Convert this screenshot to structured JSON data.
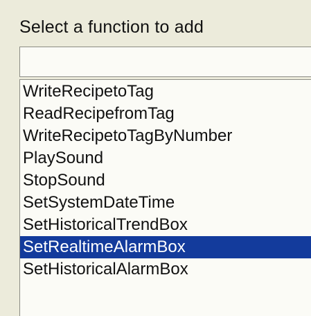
{
  "dialog": {
    "prompt": "Select a function to add",
    "search": {
      "value": "",
      "placeholder": ""
    },
    "functions": [
      "WriteRecipetoTag",
      "ReadRecipefromTag",
      "WriteRecipetoTagByNumber",
      "PlaySound",
      "StopSound",
      "SetSystemDateTime",
      "SetHistoricalTrendBox",
      "SetRealtimeAlarmBox",
      "SetHistoricalAlarmBox"
    ],
    "selected_function": "SetRealtimeAlarmBox"
  },
  "colors": {
    "background": "#ecebdb",
    "list_background": "#fbfbf6",
    "selection": "#133b9c",
    "selection_text": "#ffffff"
  }
}
